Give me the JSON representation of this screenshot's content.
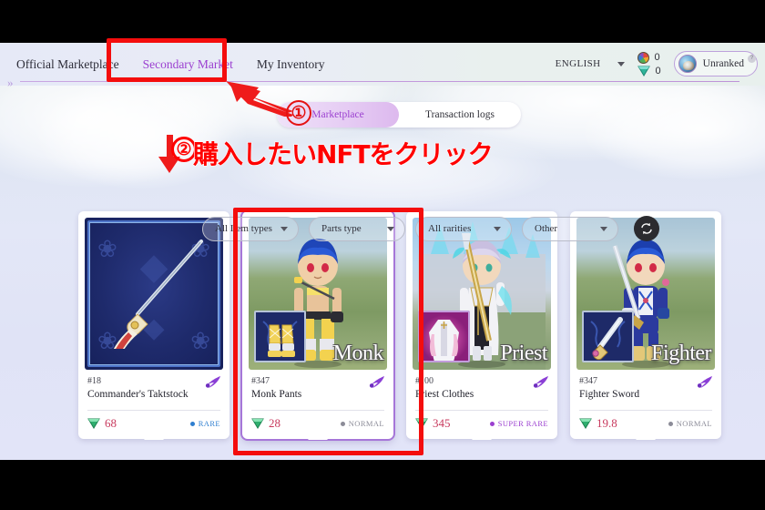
{
  "nav": {
    "links": [
      {
        "label": "Official Marketplace",
        "active": false
      },
      {
        "label": "Secondary Market",
        "active": true
      },
      {
        "label": "My Inventory",
        "active": false
      }
    ],
    "language": "ENGLISH",
    "currencies": [
      {
        "icon": "orb-coin-icon",
        "value": "0"
      },
      {
        "icon": "teal-gem-icon",
        "value": "0"
      }
    ],
    "user": {
      "name": "Unranked",
      "avatar": "user-avatar",
      "help": "?"
    }
  },
  "tabs": [
    {
      "label": "Marketplace",
      "active": true
    },
    {
      "label": "Transaction logs",
      "active": false
    }
  ],
  "filters": [
    {
      "label": "All Item types"
    },
    {
      "label": "Parts type"
    },
    {
      "label": "All rarities"
    },
    {
      "label": "Other"
    }
  ],
  "refresh": {
    "icon": "refresh-swap-icon"
  },
  "cards": [
    {
      "id": "#18",
      "title": "Commander's Taktstock",
      "price": "68",
      "rarity": "RARE",
      "rarity_color": "#2f7fd0",
      "class_label": "",
      "art": "weapon-frame",
      "selected": false
    },
    {
      "id": "#347",
      "title": "Monk Pants",
      "price": "28",
      "rarity": "NORMAL",
      "rarity_color": "#8c8c98",
      "class_label": "Monk",
      "art": "field-monk",
      "selected": true
    },
    {
      "id": "#100",
      "title": "Priest Clothes",
      "price": "345",
      "rarity": "SUPER RARE",
      "rarity_color": "#9b3fd0",
      "class_label": "Priest",
      "art": "castle-priest",
      "selected": false
    },
    {
      "id": "#347",
      "title": "Fighter Sword",
      "price": "19.8",
      "rarity": "NORMAL",
      "rarity_color": "#8c8c98",
      "class_label": "Fighter",
      "art": "field-fighter",
      "selected": false
    }
  ],
  "annotations": {
    "step1": "①",
    "step2": "②",
    "step2_text": "購入したいNFTをクリック",
    "highlight_color": "#f40d0d"
  }
}
